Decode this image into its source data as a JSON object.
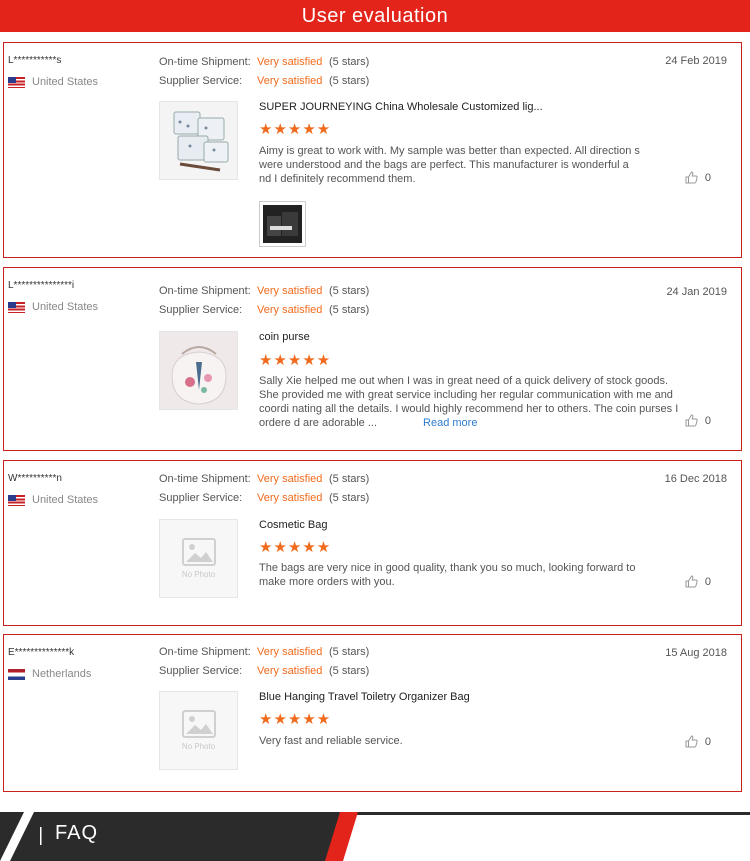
{
  "header": {
    "title": "User evaluation"
  },
  "labels": {
    "shipment": "On-time Shipment:",
    "service": "Supplier Service:",
    "read_more": "Read more",
    "no_photo": "No Photo"
  },
  "colors": {
    "accent": "#e3241b",
    "rating": "#f06b1d",
    "link": "#2c7bd0",
    "dark": "#2b2b2b"
  },
  "reviews": [
    {
      "user": "L***********s",
      "country": "United States",
      "flag": "us-flag",
      "shipment_rating": "Very satisfied",
      "shipment_stars": "(5 stars)",
      "service_rating": "Very satisfied",
      "service_stars": "(5 stars)",
      "date": "24 Feb 2019",
      "product_title": "SUPER JOURNEYING China Wholesale Customized lig...",
      "stars": "★★★★★",
      "text": "Aimy is great to work with.  My sample was better than expected.  All direction s were understood and the bags are perfect.  This manufacturer is wonderful a nd I definitely recommend them.",
      "likes": "0"
    },
    {
      "user": "L***************i",
      "country": "United States",
      "flag": "us-flag",
      "shipment_rating": "Very satisfied",
      "shipment_stars": "(5 stars)",
      "service_rating": "Very satisfied",
      "service_stars": "(5 stars)",
      "date": "24 Jan 2019",
      "product_title": "coin purse",
      "stars": "★★★★★",
      "text": "Sally Xie helped me out when I was in great need of a quick delivery of stock goods.  She provided me with great service including her regular communication with me and coordi nating all the details.  I would highly recommend her to others.  The coin purses I ordere d are adorable ...",
      "likes": "0"
    },
    {
      "user": "W**********n",
      "country": "United States",
      "flag": "us-flag",
      "shipment_rating": "Very satisfied",
      "shipment_stars": "(5 stars)",
      "service_rating": "Very satisfied",
      "service_stars": "(5 stars)",
      "date": "16 Dec 2018",
      "product_title": "Cosmetic Bag",
      "stars": "★★★★★",
      "text": "The bags are very nice in good quality, thank you so much, looking forward to make more orders with you.",
      "likes": "0"
    },
    {
      "user": "E**************k",
      "country": "Netherlands",
      "flag": "netherlands-flag",
      "shipment_rating": "Very satisfied",
      "shipment_stars": "(5 stars)",
      "service_rating": "Very satisfied",
      "service_stars": "(5 stars)",
      "date": "15 Aug 2018",
      "product_title": "Blue Hanging Travel Toiletry Organizer Bag",
      "stars": "★★★★★",
      "text": "Very fast and reliable service.",
      "likes": "0"
    }
  ],
  "footer": {
    "title": "FAQ"
  }
}
